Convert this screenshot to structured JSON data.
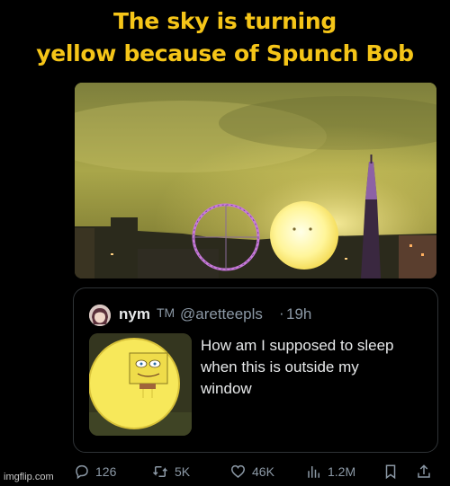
{
  "caption": {
    "line1": "The sky is turning",
    "line2": "yellow because of Spunch Bob",
    "color": "#f5c518"
  },
  "photo": {
    "subject": "sphere-with-spongebob-face",
    "colors": {
      "sky": "#8f9140",
      "glow": "#fff6a8"
    }
  },
  "tweet": {
    "name": "nym",
    "name_suffix": "TM",
    "handle": "@aretteepls",
    "separator": "·",
    "time": "19h",
    "body_lines": [
      "How am I supposed to sleep",
      "when this is outside my",
      "window"
    ]
  },
  "actions": {
    "replies": "126",
    "reposts": "5K",
    "likes": "46K",
    "views": "1.2M",
    "icons": [
      "reply-icon",
      "repost-icon",
      "like-icon",
      "views-icon",
      "bookmark-icon",
      "share-icon"
    ]
  },
  "watermark": "imgflip.com"
}
